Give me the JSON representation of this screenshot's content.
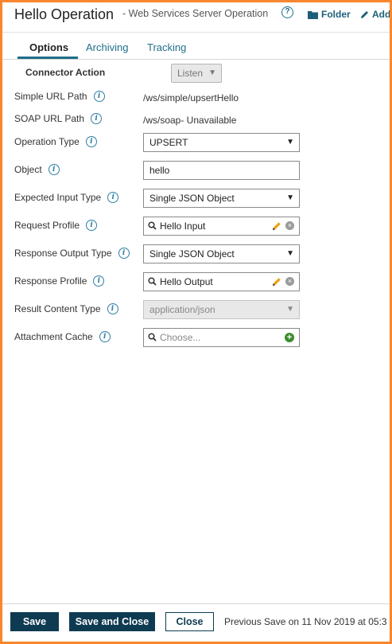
{
  "header": {
    "title": "Hello Operation",
    "subtitle": "- Web Services Server Operation",
    "folder_label": "Folder",
    "add_label": "Add"
  },
  "tabs": [
    {
      "label": "Options"
    },
    {
      "label": "Archiving"
    },
    {
      "label": "Tracking"
    }
  ],
  "form": {
    "connector_action": {
      "label": "Connector Action",
      "value": "Listen"
    },
    "simple_url_path": {
      "label": "Simple URL Path",
      "value": "/ws/simple/upsertHello"
    },
    "soap_url_path": {
      "label": "SOAP URL Path",
      "value": "/ws/soap- Unavailable"
    },
    "operation_type": {
      "label": "Operation Type",
      "value": "UPSERT"
    },
    "object": {
      "label": "Object",
      "value": "hello"
    },
    "expected_input_type": {
      "label": "Expected Input Type",
      "value": "Single JSON Object"
    },
    "request_profile": {
      "label": "Request Profile",
      "value": "Hello Input"
    },
    "response_output_type": {
      "label": "Response Output Type",
      "value": "Single JSON Object"
    },
    "response_profile": {
      "label": "Response Profile",
      "value": "Hello Output"
    },
    "result_content_type": {
      "label": "Result Content Type",
      "value": "application/json"
    },
    "attachment_cache": {
      "label": "Attachment Cache",
      "placeholder": "Choose..."
    }
  },
  "footer": {
    "save_label": "Save",
    "save_close_label": "Save and Close",
    "close_label": "Close",
    "previous_save": "Previous Save on 11 Nov 2019 at 05:3"
  },
  "colors": {
    "border_accent": "#f7862e",
    "link": "#1f6f8b",
    "primary_button": "#0f3b52"
  }
}
